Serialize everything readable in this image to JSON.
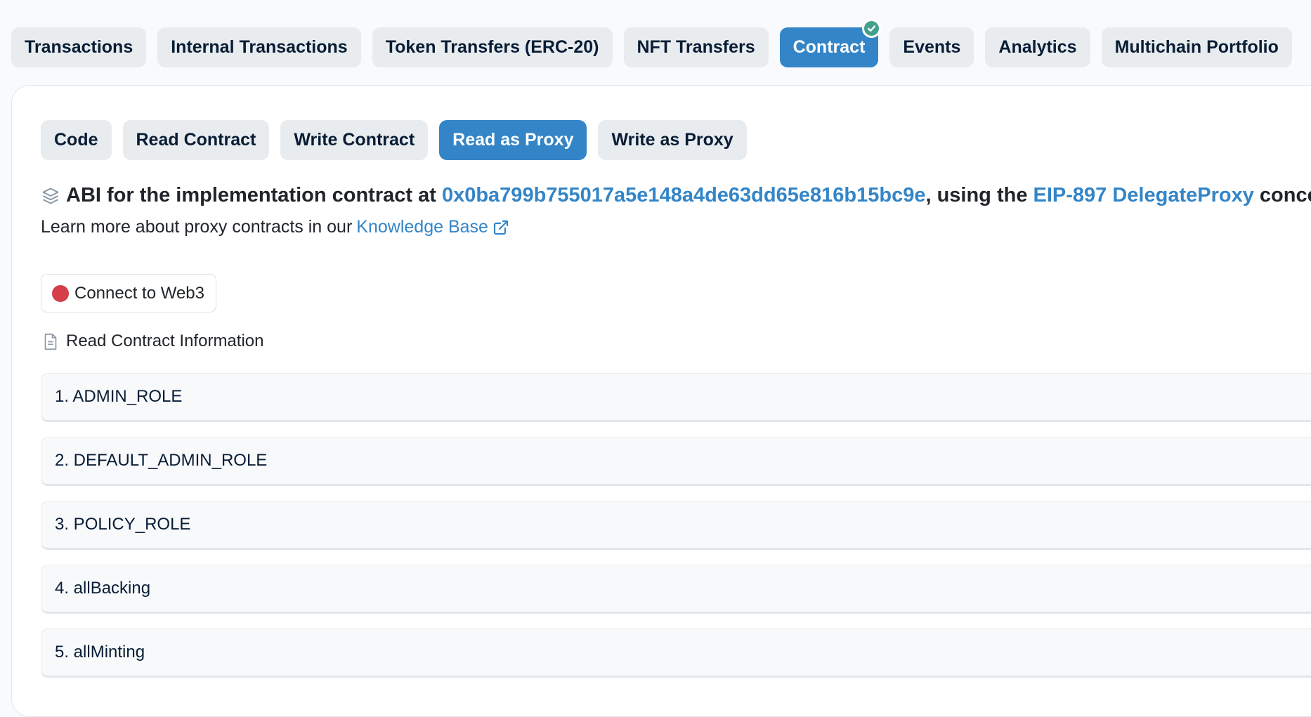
{
  "top_tabs": [
    {
      "label": "Transactions",
      "active": false
    },
    {
      "label": "Internal Transactions",
      "active": false
    },
    {
      "label": "Token Transfers (ERC-20)",
      "active": false
    },
    {
      "label": "NFT Transfers",
      "active": false
    },
    {
      "label": "Contract",
      "active": true,
      "verified": true
    },
    {
      "label": "Events",
      "active": false
    },
    {
      "label": "Analytics",
      "active": false
    },
    {
      "label": "Multichain Portfolio",
      "active": false
    }
  ],
  "sub_tabs": [
    {
      "label": "Code",
      "active": false
    },
    {
      "label": "Read Contract",
      "active": false
    },
    {
      "label": "Write Contract",
      "active": false
    },
    {
      "label": "Read as Proxy",
      "active": true
    },
    {
      "label": "Write as Proxy",
      "active": false
    }
  ],
  "abi": {
    "prefix": "ABI for the implementation contract at ",
    "address": "0x0ba799b755017a5e148a4de63dd65e816b15bc9e",
    "middle": ", using the ",
    "standard_link": "EIP-897 DelegateProxy",
    "suffix": " concept."
  },
  "learn": {
    "text": "Learn more about proxy contracts in our",
    "link": "Knowledge Base"
  },
  "connect_button": {
    "label": "Connect to Web3",
    "status_color": "#d43f4a"
  },
  "read_info_label": "Read Contract Information",
  "functions": [
    "1. ADMIN_ROLE",
    "2. DEFAULT_ADMIN_ROLE",
    "3. POLICY_ROLE",
    "4. allBacking",
    "5. allMinting"
  ],
  "colors": {
    "accent": "#3385c7",
    "pill_bg": "#e9ecef",
    "verified_badge": "#44a08d"
  },
  "icons": {
    "verified": "check-circle-icon",
    "abi": "layers-icon",
    "external": "external-link-icon",
    "status": "red-dot-icon",
    "read_info": "document-icon"
  }
}
